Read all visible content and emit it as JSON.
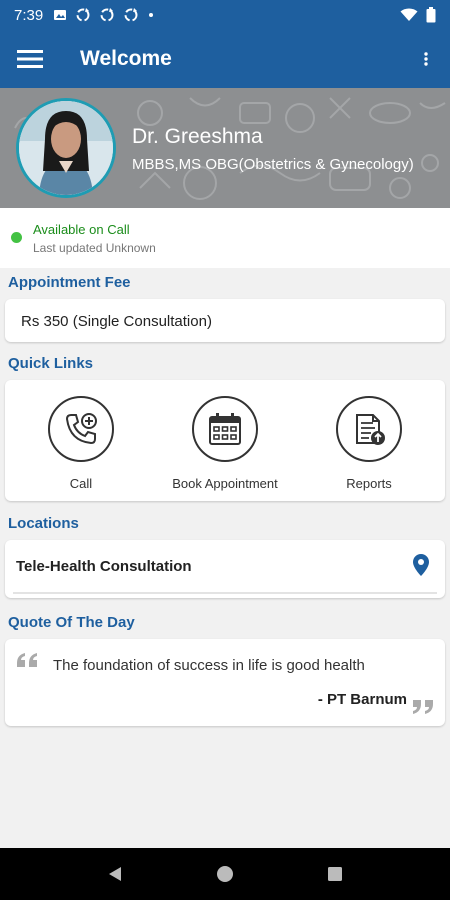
{
  "status_bar": {
    "time": "7:39",
    "icons_left": [
      "image-icon",
      "sync-icon",
      "sync-icon",
      "sync-icon",
      "dot-icon"
    ],
    "icons_right": [
      "wifi-icon",
      "battery-icon"
    ]
  },
  "app_bar": {
    "title": "Welcome",
    "menu_icon": "hamburger-menu-icon",
    "more_icon": "more-vertical-icon"
  },
  "profile": {
    "name": "Dr. Greeshma",
    "qualification": "MBBS,MS OBG(Obstetrics & Gynecology)"
  },
  "availability": {
    "status": "Available on Call",
    "last_updated": "Last updated Unknown",
    "status_color": "#43c243"
  },
  "appointment_fee": {
    "heading": "Appointment Fee",
    "text": "Rs 350 (Single Consultation)"
  },
  "quick_links": {
    "heading": "Quick Links",
    "items": [
      {
        "label": "Call",
        "icon": "phone-plus-icon"
      },
      {
        "label": "Book Appointment",
        "icon": "calendar-icon"
      },
      {
        "label": "Reports",
        "icon": "report-upload-icon"
      }
    ]
  },
  "locations": {
    "heading": "Locations",
    "items": [
      {
        "name": "Tele-Health Consultation",
        "icon": "location-pin-icon"
      }
    ]
  },
  "quote": {
    "heading": "Quote Of The Day",
    "text": "The foundation of success in life is good health",
    "author": "- PT Barnum"
  },
  "colors": {
    "primary": "#1e5f9f",
    "banner": "#8d8f91",
    "accent_border": "#1f9cb3"
  },
  "nav_bar": {
    "icons": [
      "back-icon",
      "home-icon",
      "recents-icon"
    ]
  }
}
